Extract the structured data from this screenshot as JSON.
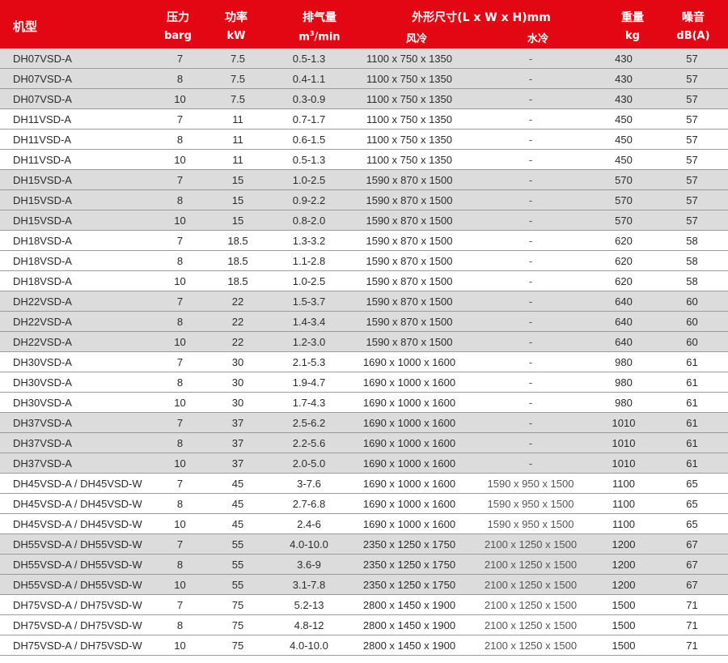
{
  "header": {
    "model": "机型",
    "pressure": "压力",
    "pressure_unit": "barg",
    "power": "功率",
    "power_unit": "kW",
    "fad": "排气量",
    "fad_unit_base": "m",
    "fad_unit_sup": "3",
    "fad_unit_rest": "/min",
    "dims": "外形尺寸(L x W x H)mm",
    "air_cooled": "风冷",
    "water_cooled": "水冷",
    "weight": "重量",
    "weight_unit": "kg",
    "noise": "噪音",
    "noise_unit": "dB(A)"
  },
  "style": {
    "header_bg": "#e30613",
    "shade_bg": "#dcdcdd",
    "rule": "#9a9a9a"
  },
  "rows": [
    {
      "model": "DH07VSD-A",
      "pressure": "7",
      "power": "7.5",
      "fad": "0.5-1.3",
      "air": "1100 x 750 x 1350",
      "water": "-",
      "weight": "430",
      "noise": "57",
      "shade": true
    },
    {
      "model": "DH07VSD-A",
      "pressure": "8",
      "power": "7.5",
      "fad": "0.4-1.1",
      "air": "1100 x 750 x 1350",
      "water": "-",
      "weight": "430",
      "noise": "57",
      "shade": true
    },
    {
      "model": "DH07VSD-A",
      "pressure": "10",
      "power": "7.5",
      "fad": "0.3-0.9",
      "air": "1100 x 750 x 1350",
      "water": "-",
      "weight": "430",
      "noise": "57",
      "shade": true
    },
    {
      "model": "DH11VSD-A",
      "pressure": "7",
      "power": "11",
      "fad": "0.7-1.7",
      "air": "1100 x 750 x 1350",
      "water": "-",
      "weight": "450",
      "noise": "57",
      "shade": false
    },
    {
      "model": "DH11VSD-A",
      "pressure": "8",
      "power": "11",
      "fad": "0.6-1.5",
      "air": "1100 x 750 x 1350",
      "water": "-",
      "weight": "450",
      "noise": "57",
      "shade": false
    },
    {
      "model": "DH11VSD-A",
      "pressure": "10",
      "power": "11",
      "fad": "0.5-1.3",
      "air": "1100 x 750 x 1350",
      "water": "-",
      "weight": "450",
      "noise": "57",
      "shade": false
    },
    {
      "model": "DH15VSD-A",
      "pressure": "7",
      "power": "15",
      "fad": "1.0-2.5",
      "air": "1590 x 870 x 1500",
      "water": "-",
      "weight": "570",
      "noise": "57",
      "shade": true
    },
    {
      "model": "DH15VSD-A",
      "pressure": "8",
      "power": "15",
      "fad": "0.9-2.2",
      "air": "1590 x 870 x 1500",
      "water": "-",
      "weight": "570",
      "noise": "57",
      "shade": true
    },
    {
      "model": "DH15VSD-A",
      "pressure": "10",
      "power": "15",
      "fad": "0.8-2.0",
      "air": "1590 x 870 x 1500",
      "water": "-",
      "weight": "570",
      "noise": "57",
      "shade": true
    },
    {
      "model": "DH18VSD-A",
      "pressure": "7",
      "power": "18.5",
      "fad": "1.3-3.2",
      "air": "1590 x 870 x 1500",
      "water": "-",
      "weight": "620",
      "noise": "58",
      "shade": false
    },
    {
      "model": "DH18VSD-A",
      "pressure": "8",
      "power": "18.5",
      "fad": "1.1-2.8",
      "air": "1590 x 870 x 1500",
      "water": "-",
      "weight": "620",
      "noise": "58",
      "shade": false
    },
    {
      "model": "DH18VSD-A",
      "pressure": "10",
      "power": "18.5",
      "fad": "1.0-2.5",
      "air": "1590 x 870 x 1500",
      "water": "-",
      "weight": "620",
      "noise": "58",
      "shade": false
    },
    {
      "model": "DH22VSD-A",
      "pressure": "7",
      "power": "22",
      "fad": "1.5-3.7",
      "air": "1590 x 870 x 1500",
      "water": "-",
      "weight": "640",
      "noise": "60",
      "shade": true
    },
    {
      "model": "DH22VSD-A",
      "pressure": "8",
      "power": "22",
      "fad": "1.4-3.4",
      "air": "1590 x 870 x 1500",
      "water": "-",
      "weight": "640",
      "noise": "60",
      "shade": true
    },
    {
      "model": "DH22VSD-A",
      "pressure": "10",
      "power": "22",
      "fad": "1.2-3.0",
      "air": "1590 x 870 x 1500",
      "water": "-",
      "weight": "640",
      "noise": "60",
      "shade": true
    },
    {
      "model": "DH30VSD-A",
      "pressure": "7",
      "power": "30",
      "fad": "2.1-5.3",
      "air": "1690 x 1000 x 1600",
      "water": "-",
      "weight": "980",
      "noise": "61",
      "shade": false
    },
    {
      "model": "DH30VSD-A",
      "pressure": "8",
      "power": "30",
      "fad": "1.9-4.7",
      "air": "1690 x 1000 x 1600",
      "water": "-",
      "weight": "980",
      "noise": "61",
      "shade": false
    },
    {
      "model": "DH30VSD-A",
      "pressure": "10",
      "power": "30",
      "fad": "1.7-4.3",
      "air": "1690 x 1000 x 1600",
      "water": "-",
      "weight": "980",
      "noise": "61",
      "shade": false
    },
    {
      "model": "DH37VSD-A",
      "pressure": "7",
      "power": "37",
      "fad": "2.5-6.2",
      "air": "1690 x 1000 x 1600",
      "water": "-",
      "weight": "1010",
      "noise": "61",
      "shade": true
    },
    {
      "model": "DH37VSD-A",
      "pressure": "8",
      "power": "37",
      "fad": "2.2-5.6",
      "air": "1690 x 1000 x 1600",
      "water": "-",
      "weight": "1010",
      "noise": "61",
      "shade": true
    },
    {
      "model": "DH37VSD-A",
      "pressure": "10",
      "power": "37",
      "fad": "2.0-5.0",
      "air": "1690 x 1000 x 1600",
      "water": "-",
      "weight": "1010",
      "noise": "61",
      "shade": true
    },
    {
      "model": "DH45VSD-A / DH45VSD-W",
      "pressure": "7",
      "power": "45",
      "fad": "3-7.6",
      "air": "1690 x 1000 x 1600",
      "water": "1590 x 950 x 1500",
      "weight": "1100",
      "noise": "65",
      "shade": false
    },
    {
      "model": "DH45VSD-A / DH45VSD-W",
      "pressure": "8",
      "power": "45",
      "fad": "2.7-6.8",
      "air": "1690 x 1000 x 1600",
      "water": "1590 x 950 x 1500",
      "weight": "1100",
      "noise": "65",
      "shade": false
    },
    {
      "model": "DH45VSD-A / DH45VSD-W",
      "pressure": "10",
      "power": "45",
      "fad": "2.4-6",
      "air": "1690 x 1000 x 1600",
      "water": "1590 x 950 x 1500",
      "weight": "1100",
      "noise": "65",
      "shade": false
    },
    {
      "model": "DH55VSD-A / DH55VSD-W",
      "pressure": "7",
      "power": "55",
      "fad": "4.0-10.0",
      "air": "2350 x 1250 x 1750",
      "water": "2100 x 1250 x 1500",
      "weight": "1200",
      "noise": "67",
      "shade": true
    },
    {
      "model": "DH55VSD-A / DH55VSD-W",
      "pressure": "8",
      "power": "55",
      "fad": "3.6-9",
      "air": "2350 x 1250 x 1750",
      "water": "2100 x 1250 x 1500",
      "weight": "1200",
      "noise": "67",
      "shade": true
    },
    {
      "model": "DH55VSD-A / DH55VSD-W",
      "pressure": "10",
      "power": "55",
      "fad": "3.1-7.8",
      "air": "2350 x 1250 x 1750",
      "water": "2100 x 1250 x 1500",
      "weight": "1200",
      "noise": "67",
      "shade": true
    },
    {
      "model": "DH75VSD-A / DH75VSD-W",
      "pressure": "7",
      "power": "75",
      "fad": "5.2-13",
      "air": "2800 x 1450 x 1900",
      "water": "2100 x 1250 x 1500",
      "weight": "1500",
      "noise": "71",
      "shade": false
    },
    {
      "model": "DH75VSD-A / DH75VSD-W",
      "pressure": "8",
      "power": "75",
      "fad": "4.8-12",
      "air": "2800 x 1450 x 1900",
      "water": "2100 x 1250 x 1500",
      "weight": "1500",
      "noise": "71",
      "shade": false
    },
    {
      "model": "DH75VSD-A / DH75VSD-W",
      "pressure": "10",
      "power": "75",
      "fad": "4.0-10.0",
      "air": "2800 x 1450 x 1900",
      "water": "2100 x 1250 x 1500",
      "weight": "1500",
      "noise": "71",
      "shade": false
    }
  ]
}
